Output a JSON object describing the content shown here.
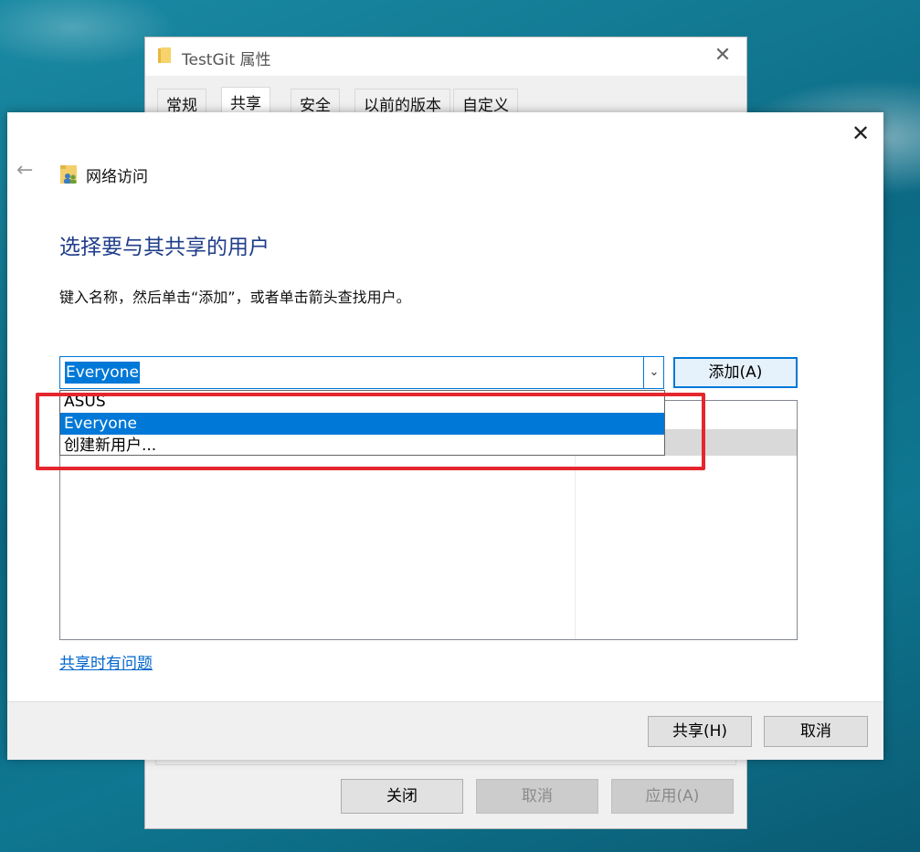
{
  "properties_window": {
    "title": "TestGit 属性",
    "tabs": [
      "常规",
      "共享",
      "安全",
      "以前的版本",
      "自定义"
    ],
    "selected_tab": "共享",
    "buttons": {
      "close": "关闭",
      "cancel": "取消",
      "apply": "应用(A)"
    }
  },
  "share_dialog": {
    "breadcrumb": "网络访问",
    "heading": "选择要与其共享的用户",
    "instruction": "键入名称，然后单击“添加”，或者单击箭头查找用户。",
    "combo_value": "Everyone",
    "add_button": "添加(A)",
    "dropdown_items": [
      "ASUS",
      "Everyone",
      "创建新用户..."
    ],
    "dropdown_selected": "Everyone",
    "trouble_link": "共享时有问题",
    "footer_buttons": {
      "share": "共享(H)",
      "cancel": "取消"
    }
  },
  "annotation": {
    "highlight_color": "#e5262d"
  },
  "colors": {
    "accent": "#0078d7",
    "heading": "#1f3d8a",
    "link": "#0066cc"
  }
}
